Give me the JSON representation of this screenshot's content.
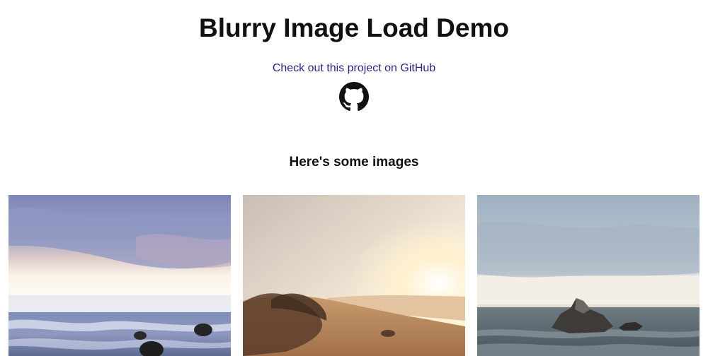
{
  "header": {
    "title": "Blurry Image Load Demo",
    "github_link_text": "Check out this project on GitHub",
    "github_icon": "github-octocat-icon"
  },
  "section": {
    "heading": "Here's some images"
  },
  "gallery": {
    "images": [
      {
        "name": "beach-rocks-waves",
        "colors": {
          "sky": "#8b93bd",
          "glow": "#fdf8f0",
          "sea": "#6f7ea6"
        }
      },
      {
        "name": "beach-sunset-dunes",
        "colors": {
          "sky": "#d8c9b8",
          "sun": "#fff6e0",
          "sand": "#b98a5f"
        }
      },
      {
        "name": "sea-rock-overcast",
        "colors": {
          "sky": "#a4b5c6",
          "sea": "#55636d",
          "rock": "#3b3a38"
        }
      }
    ]
  },
  "theme": {
    "link_color": "#3b1a86",
    "text_color": "#111111"
  }
}
